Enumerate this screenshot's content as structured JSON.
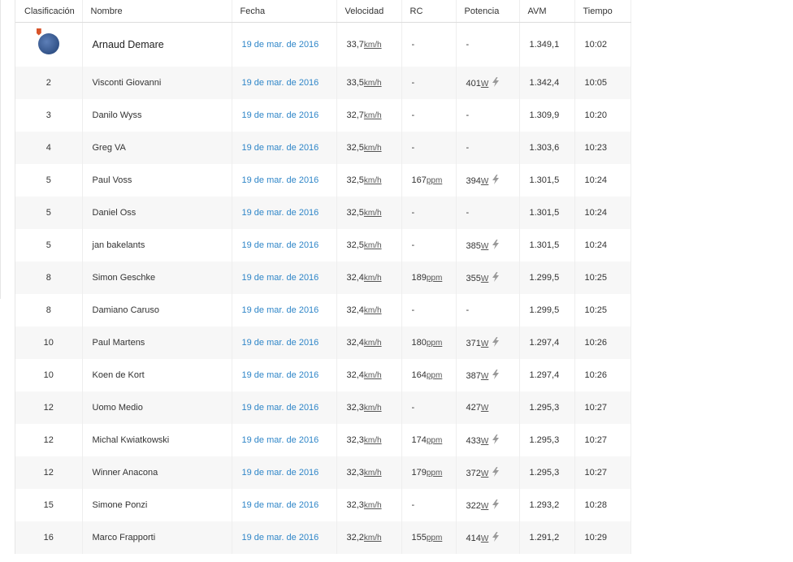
{
  "headers": [
    "Clasificación",
    "Nombre",
    "Fecha",
    "Velocidad",
    "RC",
    "Potencia",
    "AVM",
    "Tiempo"
  ],
  "units": {
    "speed": "km/h",
    "hr": "ppm",
    "power": "W"
  },
  "rows": [
    {
      "rank": "",
      "name": "Arnaud Demare",
      "date": "19 de mar. de 2016",
      "speed": "33,7",
      "hr": "-",
      "power": "-",
      "power_meter": false,
      "vam": "1.349,1",
      "time": "10:02"
    },
    {
      "rank": "2",
      "name": "Visconti Giovanni",
      "date": "19 de mar. de 2016",
      "speed": "33,5",
      "hr": "-",
      "power": "401",
      "power_meter": true,
      "vam": "1.342,4",
      "time": "10:05"
    },
    {
      "rank": "3",
      "name": "Danilo Wyss",
      "date": "19 de mar. de 2016",
      "speed": "32,7",
      "hr": "-",
      "power": "-",
      "power_meter": false,
      "vam": "1.309,9",
      "time": "10:20"
    },
    {
      "rank": "4",
      "name": "Greg VA",
      "date": "19 de mar. de 2016",
      "speed": "32,5",
      "hr": "-",
      "power": "-",
      "power_meter": false,
      "vam": "1.303,6",
      "time": "10:23"
    },
    {
      "rank": "5",
      "name": "Paul Voss",
      "date": "19 de mar. de 2016",
      "speed": "32,5",
      "hr": "167",
      "power": "394",
      "power_meter": true,
      "vam": "1.301,5",
      "time": "10:24"
    },
    {
      "rank": "5",
      "name": "Daniel Oss",
      "date": "19 de mar. de 2016",
      "speed": "32,5",
      "hr": "-",
      "power": "-",
      "power_meter": false,
      "vam": "1.301,5",
      "time": "10:24"
    },
    {
      "rank": "5",
      "name": "jan bakelants",
      "date": "19 de mar. de 2016",
      "speed": "32,5",
      "hr": "-",
      "power": "385",
      "power_meter": true,
      "vam": "1.301,5",
      "time": "10:24"
    },
    {
      "rank": "8",
      "name": "Simon Geschke",
      "date": "19 de mar. de 2016",
      "speed": "32,4",
      "hr": "189",
      "power": "355",
      "power_meter": true,
      "vam": "1.299,5",
      "time": "10:25"
    },
    {
      "rank": "8",
      "name": "Damiano Caruso",
      "date": "19 de mar. de 2016",
      "speed": "32,4",
      "hr": "-",
      "power": "-",
      "power_meter": false,
      "vam": "1.299,5",
      "time": "10:25"
    },
    {
      "rank": "10",
      "name": "Paul Martens",
      "date": "19 de mar. de 2016",
      "speed": "32,4",
      "hr": "180",
      "power": "371",
      "power_meter": true,
      "vam": "1.297,4",
      "time": "10:26"
    },
    {
      "rank": "10",
      "name": "Koen de Kort",
      "date": "19 de mar. de 2016",
      "speed": "32,4",
      "hr": "164",
      "power": "387",
      "power_meter": true,
      "vam": "1.297,4",
      "time": "10:26"
    },
    {
      "rank": "12",
      "name": "Uomo Medio",
      "date": "19 de mar. de 2016",
      "speed": "32,3",
      "hr": "-",
      "power": "427",
      "power_meter": false,
      "vam": "1.295,3",
      "time": "10:27"
    },
    {
      "rank": "12",
      "name": "Michal Kwiatkowski",
      "date": "19 de mar. de 2016",
      "speed": "32,3",
      "hr": "174",
      "power": "433",
      "power_meter": true,
      "vam": "1.295,3",
      "time": "10:27"
    },
    {
      "rank": "12",
      "name": "Winner Anacona",
      "date": "19 de mar. de 2016",
      "speed": "32,3",
      "hr": "179",
      "power": "372",
      "power_meter": true,
      "vam": "1.295,3",
      "time": "10:27"
    },
    {
      "rank": "15",
      "name": "Simone Ponzi",
      "date": "19 de mar. de 2016",
      "speed": "32,3",
      "hr": "-",
      "power": "322",
      "power_meter": true,
      "vam": "1.293,2",
      "time": "10:28"
    },
    {
      "rank": "16",
      "name": "Marco Frapporti",
      "date": "19 de mar. de 2016",
      "speed": "32,2",
      "hr": "155",
      "power": "414",
      "power_meter": true,
      "vam": "1.291,2",
      "time": "10:29"
    }
  ]
}
